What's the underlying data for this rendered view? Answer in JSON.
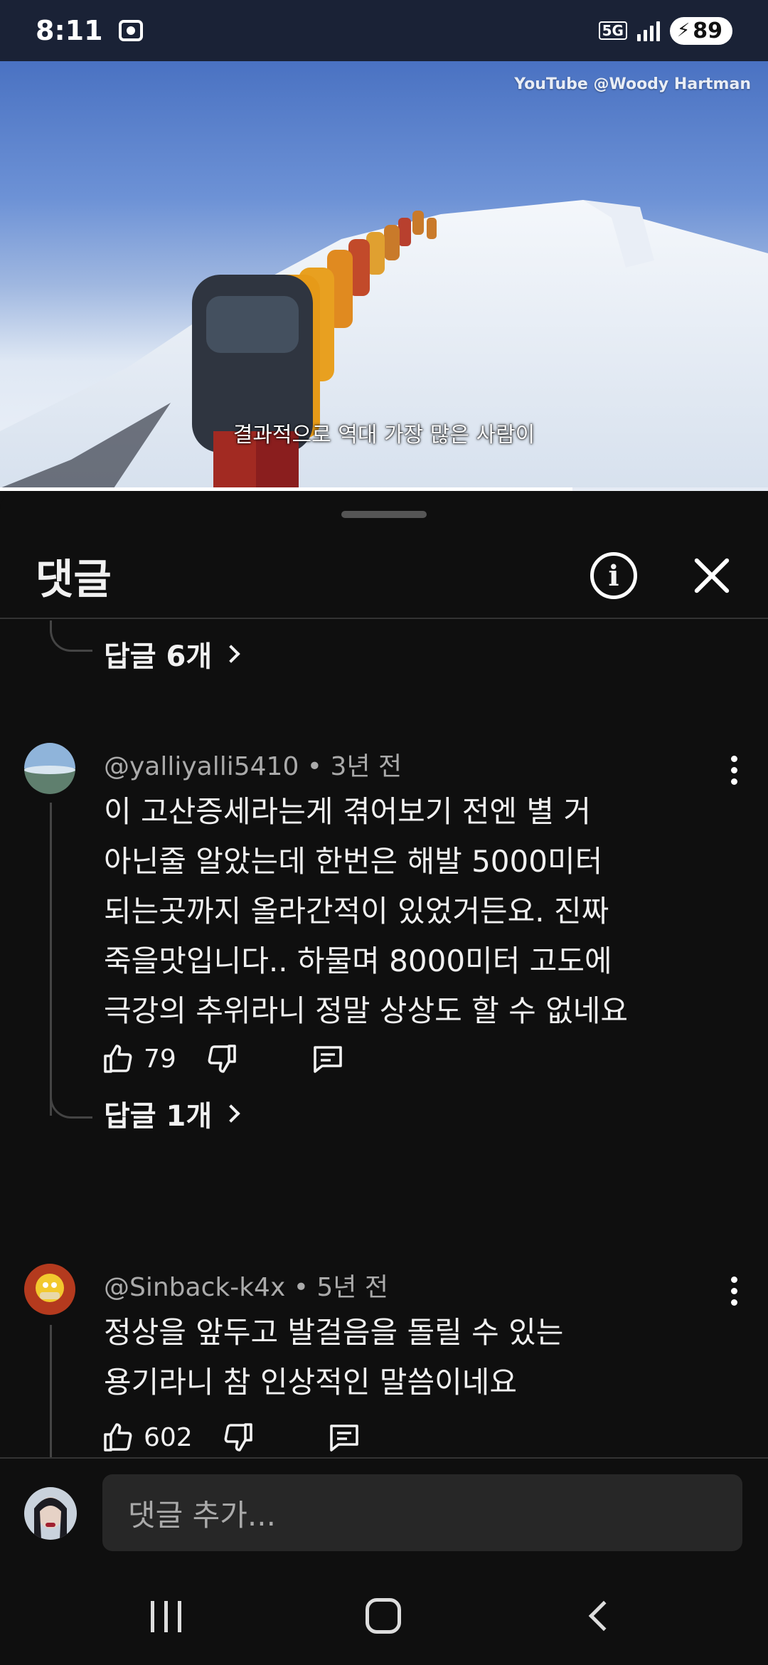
{
  "status_bar": {
    "time": "8:11",
    "network": "5G",
    "battery": "89",
    "icons": [
      "screen-record-icon",
      "signal-icon",
      "battery-charging-icon"
    ]
  },
  "video": {
    "watermark": "YouTube @Woody Hartman",
    "subtitle": "결과적으로 역대 가장 많은 사람이",
    "progress_fraction": 0.745
  },
  "comments_panel": {
    "title": "댓글",
    "info_icon": "info-icon",
    "close_icon": "close-icon"
  },
  "thread": {
    "previous_replies_label": "답글 6개"
  },
  "comments": [
    {
      "author": "@yalliyalli5410",
      "age": "3년 전",
      "text": "이 고산증세라는게 겪어보기 전엔 별 거\n아닌줄 알았는데 한번은 해발 5000미터\n되는곳까지 올라간적이 있었거든요. 진짜\n죽을맛입니다.. 하물며 8000미터 고도에\n극강의 추위라니 정말 상상도 할 수 없네요",
      "likes": "79",
      "replies_label": "답글 1개"
    },
    {
      "author": "@Sinback-k4x",
      "age": "5년 전",
      "text": "정상을 앞두고 발걸음을 돌릴 수 있는\n용기라니 참 인상적인 말씀이네요",
      "likes": "602"
    }
  ],
  "input": {
    "placeholder": "댓글 추가..."
  },
  "nav": {
    "icons": [
      "recents-icon",
      "home-icon",
      "back-icon"
    ]
  }
}
